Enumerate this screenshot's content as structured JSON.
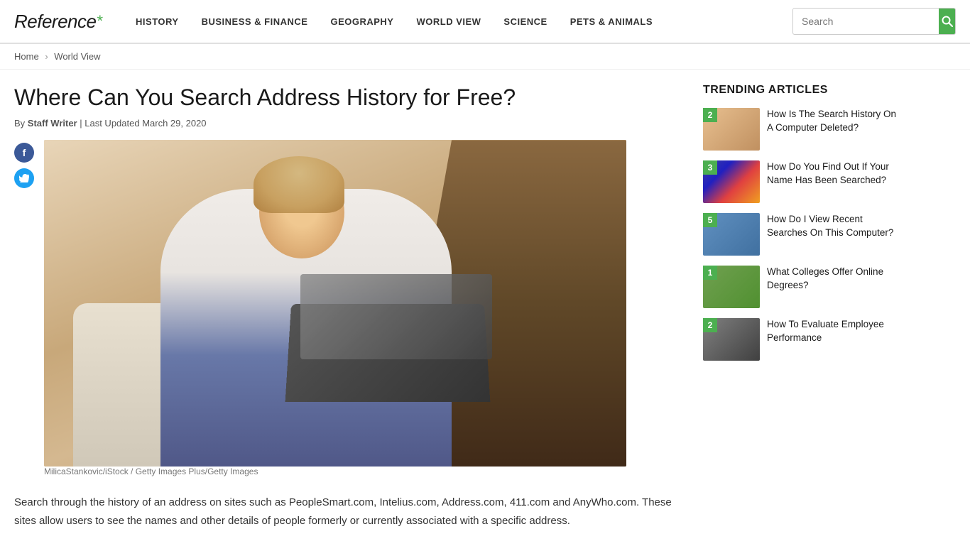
{
  "nav": {
    "logo": "Reference",
    "logo_asterisk": "*",
    "links": [
      "History",
      "Business & Finance",
      "Geography",
      "World View",
      "Science",
      "Pets & Animals"
    ],
    "search_placeholder": "Search"
  },
  "breadcrumb": {
    "home": "Home",
    "sep": "›",
    "current": "World View"
  },
  "article": {
    "title": "Where Can You Search Address History for Free?",
    "by_label": "By",
    "author": "Staff Writer",
    "separator": "|",
    "last_updated": "Last Updated March 29, 2020",
    "image_caption": "MilicaStankovic/iStock / Getty Images Plus/Getty Images",
    "body_p1": "Search through the history of an address on sites such as PeopleSmart.com, Intelius.com, Address.com, 411.com and AnyWho.com. These sites allow users to see the names and other details of people formerly or currently associated with a specific address."
  },
  "sidebar": {
    "trending_title": "TRENDING ARTICLES",
    "items": [
      {
        "badge": "2",
        "title": "How Is The Search History On A Computer Deleted?",
        "img_class": "ti1"
      },
      {
        "badge": "3",
        "title": "How Do You Find Out If Your Name Has Been Searched?",
        "img_class": "ti2"
      },
      {
        "badge": "5",
        "title": "How Do I View Recent Searches On This Computer?",
        "img_class": "ti3"
      },
      {
        "badge": "1",
        "title": "What Colleges Offer Online Degrees?",
        "img_class": "ti4"
      },
      {
        "badge": "2",
        "title": "How To Evaluate Employee Performance",
        "img_class": "ti5"
      }
    ]
  }
}
